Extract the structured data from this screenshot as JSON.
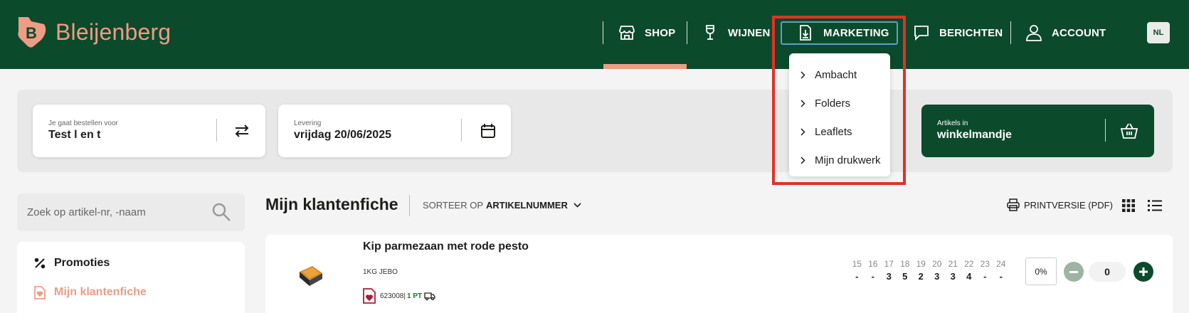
{
  "brand": {
    "name": "Bleijenberg",
    "logo_letter": "B"
  },
  "nav": {
    "items": [
      {
        "label": "SHOP",
        "icon": "store-icon"
      },
      {
        "label": "WIJNEN",
        "icon": "wine-glass-icon"
      },
      {
        "label": "MARKETING",
        "icon": "download-file-icon"
      },
      {
        "label": "BERICHTEN",
        "icon": "chat-icon"
      },
      {
        "label": "ACCOUNT",
        "icon": "user-icon"
      }
    ],
    "language": "NL"
  },
  "marketing_menu": {
    "items": [
      "Ambacht",
      "Folders",
      "Leaflets",
      "Mijn drukwerk"
    ]
  },
  "order": {
    "customer_label": "Je gaat bestellen voor",
    "customer_value": "Test l en t",
    "delivery_label": "Levering",
    "delivery_value": "vrijdag 20/06/2025",
    "cart_label": "Artikels in",
    "cart_value": "winkelmandje"
  },
  "sidebar": {
    "search_placeholder": "Zoek op artikel-nr, -naam",
    "items": [
      {
        "label": "Promoties",
        "icon": "percent-icon"
      },
      {
        "label": "Mijn klantenfiche",
        "icon": "favorite-file-icon"
      }
    ]
  },
  "main": {
    "title": "Mijn klantenfiche",
    "sort_prefix": "SORTEER OP",
    "sort_value": "ARTIKELNUMMER",
    "print_label": "PRINTVERSIE (PDF)"
  },
  "product": {
    "name": "Kip parmezaan met rode pesto",
    "unit": "1KG JEBO",
    "article_number": "623008",
    "separator": "|",
    "pack": "1 PT",
    "days": [
      "15",
      "16",
      "17",
      "18",
      "19",
      "20",
      "21",
      "22",
      "23",
      "24"
    ],
    "quantities": [
      "-",
      "-",
      "3",
      "5",
      "2",
      "3",
      "3",
      "4",
      "-",
      "-"
    ],
    "discount": "0%",
    "quantity": "0"
  },
  "colors": {
    "header_green": "#0c4a2c",
    "brand_salmon": "#ee9c86",
    "highlight_red": "#e33126",
    "focus_blue": "#5ea0c6"
  }
}
